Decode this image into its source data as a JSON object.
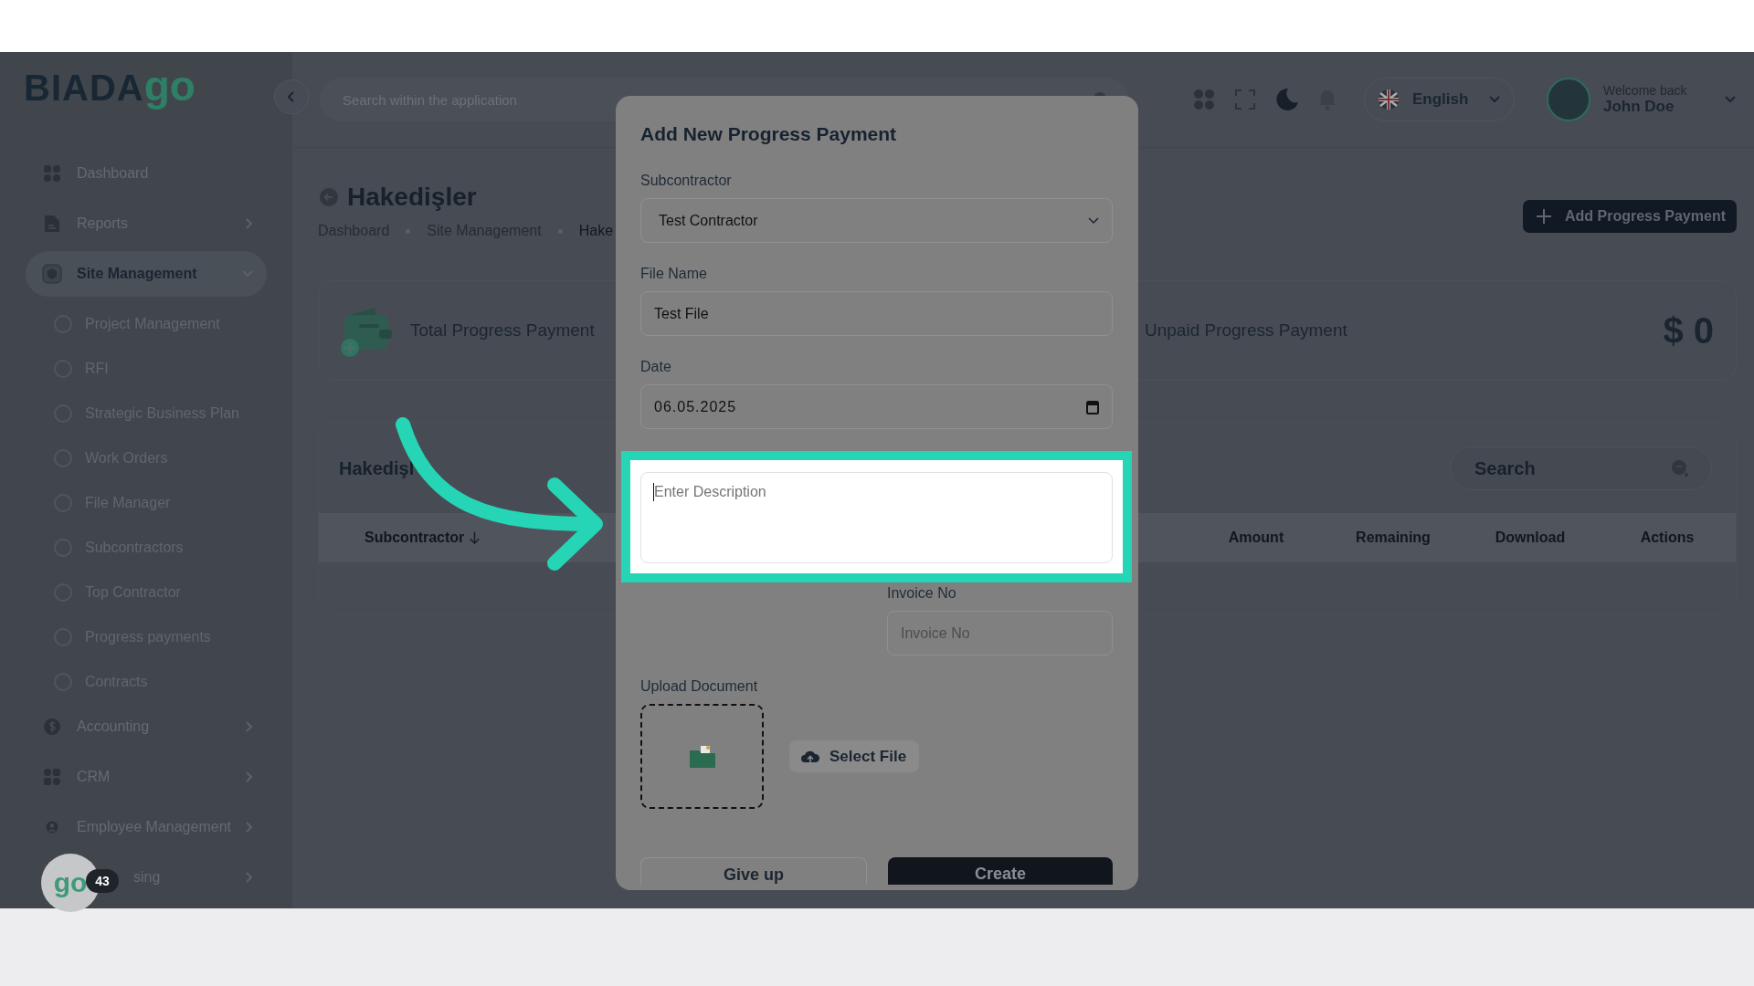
{
  "logo": {
    "text": "BIADA",
    "accent": "go"
  },
  "sidebar": {
    "items": [
      {
        "label": "Dashboard",
        "expandable": false,
        "selected": false
      },
      {
        "label": "Reports",
        "expandable": true,
        "expanded": false,
        "selected": false
      },
      {
        "label": "Site Management",
        "expandable": true,
        "expanded": true,
        "selected": true,
        "children": [
          {
            "label": "Project Management"
          },
          {
            "label": "RFI"
          },
          {
            "label": "Strategic Business Plan"
          },
          {
            "label": "Work Orders"
          },
          {
            "label": "File Manager"
          },
          {
            "label": "Subcontractors"
          },
          {
            "label": "Top Contractor"
          },
          {
            "label": "Progress payments"
          },
          {
            "label": "Contracts"
          }
        ]
      },
      {
        "label": "Accounting",
        "expandable": true,
        "expanded": false,
        "selected": false
      },
      {
        "label": "CRM",
        "expandable": true,
        "expanded": false,
        "selected": false
      },
      {
        "label": "Employee Management",
        "expandable": true,
        "expanded": false,
        "selected": false
      },
      {
        "label": "sing",
        "expandable": true,
        "expanded": false,
        "selected": false,
        "obscured": true
      }
    ]
  },
  "help_badge": {
    "logo": "go",
    "count": "43"
  },
  "header": {
    "search": {
      "placeholder": "Search within the application"
    },
    "language": "English",
    "user": {
      "greeting": "Welcome back",
      "name": "John Doe"
    }
  },
  "page": {
    "title": "Hakedişler",
    "breadcrumb": [
      "Dashboard",
      "Site Management",
      "Hake"
    ],
    "add_button": "Add Progress Payment",
    "stats": [
      {
        "label": "Total Progress Payment"
      },
      {
        "label": "Unpaid Progress Payment",
        "value": "$ 0"
      }
    ],
    "table": {
      "title": "Hakedişl",
      "search": {
        "placeholder": "Search"
      },
      "columns": [
        {
          "label": "Subcontractor",
          "sorted": true
        },
        {
          "label": "Amount",
          "sorted": false
        },
        {
          "label": "Remaining",
          "sorted": false
        },
        {
          "label": "Download",
          "sorted": false
        },
        {
          "label": "Actions",
          "sorted": false
        }
      ]
    }
  },
  "modal": {
    "title": "Add New Progress Payment",
    "fields": [
      {
        "kind": "select",
        "label": "Subcontractor",
        "value": "Test Contractor"
      },
      {
        "kind": "text",
        "label": "File Name",
        "value": "Test File"
      },
      {
        "kind": "date",
        "label": "Date",
        "value": "06.05.2025"
      },
      {
        "kind": "textarea",
        "placeholder": "Enter Description",
        "highlighted": true
      },
      {
        "kind": "half",
        "label": "Invoice No",
        "placeholder": "Invoice No"
      }
    ],
    "upload": {
      "label": "Upload Document",
      "button": "Select File"
    },
    "actions": [
      {
        "kind": "secondary",
        "label": "Give up"
      },
      {
        "kind": "primary",
        "label": "Create"
      }
    ]
  }
}
